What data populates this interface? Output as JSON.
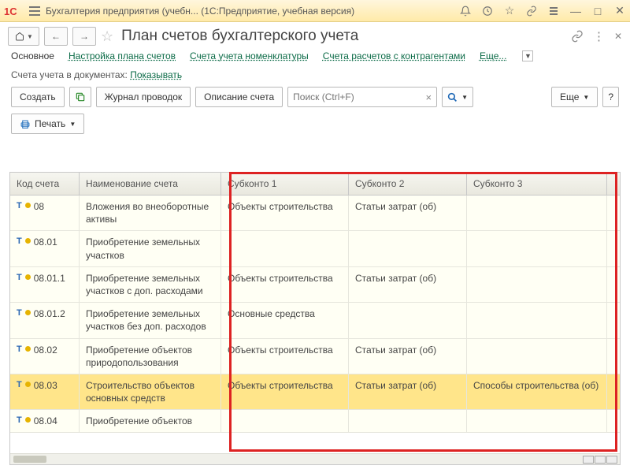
{
  "titlebar": {
    "title": "Бухгалтерия предприятия (учебн...   (1С:Предприятие, учебная версия)"
  },
  "page": {
    "heading": "План счетов бухгалтерского учета"
  },
  "tabs": {
    "main": "Основное",
    "setup": "Настройка плана счетов",
    "nomen": "Счета учета номенклатуры",
    "contr": "Счета расчетов с контрагентами",
    "more": "Еще..."
  },
  "filter": {
    "label": "Счета учета в документах:",
    "link": "Показывать"
  },
  "toolbar": {
    "create": "Создать",
    "journal": "Журнал проводок",
    "desc": "Описание счета",
    "search_placeholder": "Поиск (Ctrl+F)",
    "more": "Еще",
    "print": "Печать"
  },
  "headers": {
    "code": "Код счета",
    "name": "Наименование счета",
    "s1": "Субконто 1",
    "s2": "Субконто 2",
    "s3": "Субконто 3"
  },
  "rows": [
    {
      "code": "08",
      "name": "Вложения во внеоборотные активы",
      "s1": "Объекты строительства",
      "s2": "Статьи затрат (об)",
      "s3": ""
    },
    {
      "code": "08.01",
      "name": "Приобретение земельных участков",
      "s1": "",
      "s2": "",
      "s3": ""
    },
    {
      "code": "08.01.1",
      "name": "Приобретение земельных участков с доп. расходами",
      "s1": "Объекты строительства",
      "s2": "Статьи затрат (об)",
      "s3": ""
    },
    {
      "code": "08.01.2",
      "name": "Приобретение земельных участков без доп. расходов",
      "s1": "Основные средства",
      "s2": "",
      "s3": ""
    },
    {
      "code": "08.02",
      "name": "Приобретение объектов природопользования",
      "s1": "Объекты строительства",
      "s2": "Статьи затрат (об)",
      "s3": ""
    },
    {
      "code": "08.03",
      "name": "Строительство объектов основных средств",
      "s1": "Объекты строительства",
      "s2": "Статьи затрат (об)",
      "s3": "Способы строительства (об)"
    },
    {
      "code": "08.04",
      "name": "Приобретение объектов",
      "s1": "",
      "s2": "",
      "s3": ""
    }
  ],
  "selected_index": 5
}
